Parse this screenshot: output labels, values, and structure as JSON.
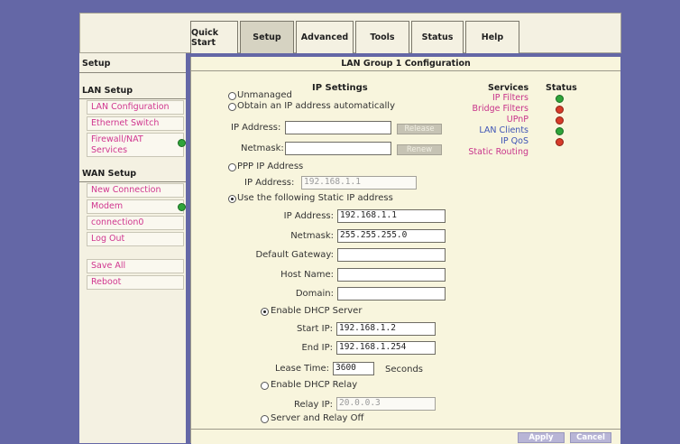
{
  "tabs": [
    {
      "label": "Quick Start",
      "active": false
    },
    {
      "label": "Setup",
      "active": true
    },
    {
      "label": "Advanced",
      "active": false
    },
    {
      "label": "Tools",
      "active": false
    },
    {
      "label": "Status",
      "active": false
    },
    {
      "label": "Help",
      "active": false
    }
  ],
  "sidebar": {
    "title": "Setup",
    "lan_header": "LAN Setup",
    "lan_items": [
      "LAN Configuration",
      "Ethernet Switch",
      "Firewall/NAT Services"
    ],
    "wan_header": "WAN Setup",
    "wan_items": [
      "New Connection",
      "Modem",
      "connection0",
      "Log Out"
    ],
    "extra_items": [
      "Save All",
      "Reboot"
    ],
    "status": {
      "firewall": "green",
      "modem": "green"
    }
  },
  "main": {
    "title": "LAN Group 1 Configuration",
    "ip_settings_heading": "IP Settings",
    "unmanaged": "Unmanaged",
    "obtain_auto": "Obtain an IP address automatically",
    "auto_ip_label": "IP Address:",
    "auto_netmask_label": "Netmask:",
    "release_btn": "Release",
    "renew_btn": "Renew",
    "ppp_label": "PPP IP Address",
    "ppp_ip_label": "IP Address:",
    "ppp_ip_value": "192.168.1.1",
    "static_label": "Use the following Static IP address",
    "static_ip_label": "IP Address:",
    "static_ip_value": "192.168.1.1",
    "netmask_label": "Netmask:",
    "netmask_value": "255.255.255.0",
    "gateway_label": "Default Gateway:",
    "gateway_value": "",
    "hostname_label": "Host Name:",
    "hostname_value": "",
    "domain_label": "Domain:",
    "domain_value": "",
    "dhcp_server_label": "Enable DHCP Server",
    "start_ip_label": "Start IP:",
    "start_ip_value": "192.168.1.2",
    "end_ip_label": "End IP:",
    "end_ip_value": "192.168.1.254",
    "lease_label": "Lease Time:",
    "lease_value": "3600",
    "lease_unit": "Seconds",
    "dhcp_relay_label": "Enable DHCP Relay",
    "relay_ip_label": "Relay IP:",
    "relay_ip_value": "20.0.0.3",
    "off_label": "Server and Relay Off",
    "selected_ip_mode": "static",
    "selected_dhcp_mode": "server"
  },
  "services": {
    "heading": "Services",
    "status_heading": "Status",
    "items": [
      {
        "label": "IP Filters",
        "status": "green"
      },
      {
        "label": "Bridge Filters",
        "status": "red"
      },
      {
        "label": "UPnP",
        "status": "red"
      },
      {
        "label": "LAN Clients",
        "status": "green"
      },
      {
        "label": "IP QoS",
        "status": "red"
      },
      {
        "label": "Static Routing",
        "status": ""
      }
    ]
  },
  "actions": {
    "apply": "Apply",
    "cancel": "Cancel"
  },
  "colors": {
    "background": "#6467a6",
    "panel": "#f8f5dd",
    "link": "#d0368f",
    "link_blue": "#3e54b5",
    "status_green": "#2fa43a",
    "status_red": "#d63b2a"
  }
}
